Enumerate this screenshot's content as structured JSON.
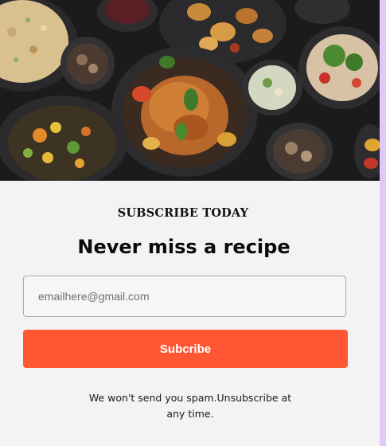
{
  "subscribe": {
    "eyebrow": "SUBSCRIBE TODAY",
    "headline": "Never miss a recipe",
    "email_placeholder": "emailhere@gmail.com",
    "button_label": "Subcribe",
    "fineprint": "We won't send you spam.Unsubscribe at any time."
  },
  "colors": {
    "button": "#ff5733",
    "card_background": "#f3f3f3",
    "page_background": "#e6d2f7"
  },
  "hero_image": {
    "icon": "food-spread-photo"
  }
}
